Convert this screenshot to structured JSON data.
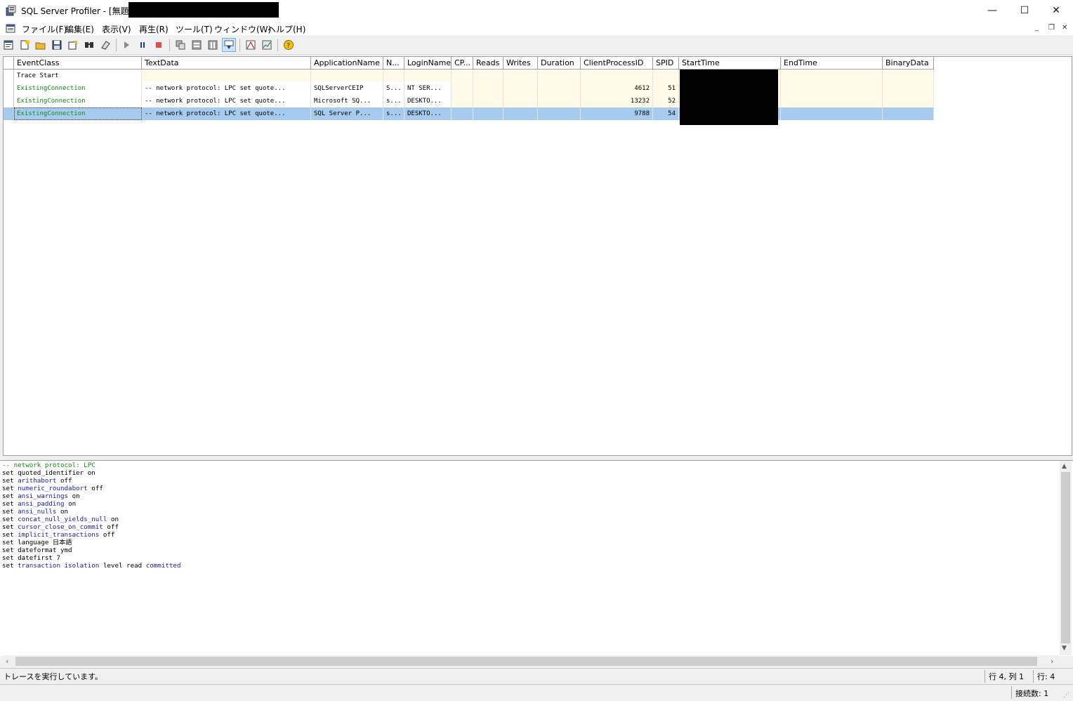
{
  "window": {
    "title": "SQL Server Profiler - [無題 - 2",
    "controls": {
      "minimize": "—",
      "maximize": "☐",
      "close": "✕"
    }
  },
  "menu": {
    "items": [
      "ファイル(F)",
      "編集(E)",
      "表示(V)",
      "再生(R)",
      "ツール(T)",
      "ウィンドウ(W)",
      "ヘルプ(H)"
    ],
    "mdi_controls": {
      "minimize": "_",
      "restore": "❐",
      "close": "✕"
    }
  },
  "toolbar": {
    "buttons": [
      "properties-icon",
      "new-trace-icon",
      "open-icon",
      "save-icon",
      "template-icon",
      "find-icon",
      "clear-icon",
      "play-icon",
      "pause-icon",
      "stop-icon",
      "group-icon",
      "filter-icon",
      "columns-icon",
      "autoscroll-icon",
      "perfmon-icon",
      "chart-icon",
      "help-icon"
    ]
  },
  "grid": {
    "columns": [
      "EventClass",
      "TextData",
      "ApplicationName",
      "N...",
      "LoginName",
      "CP...",
      "Reads",
      "Writes",
      "Duration",
      "ClientProcessID",
      "SPID",
      "StartTime",
      "EndTime",
      "BinaryData"
    ],
    "rows": [
      {
        "EventClass": "Trace Start",
        "TextData": "",
        "ApplicationName": "",
        "NTUserName": "",
        "LoginName": "",
        "CPU": "",
        "Reads": "",
        "Writes": "",
        "Duration": "",
        "ClientProcessID": "",
        "SPID": "",
        "StartTime": "",
        "EndTime": "",
        "BinaryData": ""
      },
      {
        "EventClass": "ExistingConnection",
        "TextData": "-- network protocol: LPC  set quote...",
        "ApplicationName": "SQLServerCEIP",
        "NTUserName": "S...",
        "LoginName": "NT SER...",
        "CPU": "",
        "Reads": "",
        "Writes": "",
        "Duration": "",
        "ClientProcessID": "4612",
        "SPID": "51",
        "StartTime": "",
        "EndTime": "",
        "BinaryData": ""
      },
      {
        "EventClass": "ExistingConnection",
        "TextData": "-- network protocol: LPC  set quote...",
        "ApplicationName": "Microsoft SQ...",
        "NTUserName": "s...",
        "LoginName": "DESKTO...",
        "CPU": "",
        "Reads": "",
        "Writes": "",
        "Duration": "",
        "ClientProcessID": "13232",
        "SPID": "52",
        "StartTime": "",
        "EndTime": "",
        "BinaryData": ""
      },
      {
        "EventClass": "ExistingConnection",
        "TextData": "-- network protocol: LPC  set quote...",
        "ApplicationName": "SQL Server P...",
        "NTUserName": "s...",
        "LoginName": "DESKTO...",
        "CPU": "",
        "Reads": "",
        "Writes": "",
        "Duration": "",
        "ClientProcessID": "9788",
        "SPID": "54",
        "StartTime": "",
        "EndTime": "",
        "BinaryData": ""
      }
    ],
    "selected_row": 3
  },
  "detail": {
    "lines": [
      {
        "parts": [
          {
            "t": "-- network protocol: LPC",
            "c": "cm"
          }
        ]
      },
      {
        "parts": [
          {
            "t": "set quoted_identifier on",
            "c": ""
          }
        ]
      },
      {
        "parts": [
          {
            "t": "set ",
            "c": ""
          },
          {
            "t": "arithabort",
            "c": "kw"
          },
          {
            "t": " off",
            "c": ""
          }
        ]
      },
      {
        "parts": [
          {
            "t": "set ",
            "c": ""
          },
          {
            "t": "numeric_roundabort",
            "c": "kw"
          },
          {
            "t": " off",
            "c": ""
          }
        ]
      },
      {
        "parts": [
          {
            "t": "set ",
            "c": ""
          },
          {
            "t": "ansi_warnings",
            "c": "kw"
          },
          {
            "t": " on",
            "c": ""
          }
        ]
      },
      {
        "parts": [
          {
            "t": "set ",
            "c": ""
          },
          {
            "t": "ansi_padding",
            "c": "kw"
          },
          {
            "t": " on",
            "c": ""
          }
        ]
      },
      {
        "parts": [
          {
            "t": "set ",
            "c": ""
          },
          {
            "t": "ansi_nulls",
            "c": "kw"
          },
          {
            "t": " on",
            "c": ""
          }
        ]
      },
      {
        "parts": [
          {
            "t": "set ",
            "c": ""
          },
          {
            "t": "concat_null_yields_null",
            "c": "kw"
          },
          {
            "t": " on",
            "c": ""
          }
        ]
      },
      {
        "parts": [
          {
            "t": "set ",
            "c": ""
          },
          {
            "t": "cursor_close_on_commit",
            "c": "kw"
          },
          {
            "t": " off",
            "c": ""
          }
        ]
      },
      {
        "parts": [
          {
            "t": "set ",
            "c": ""
          },
          {
            "t": "implicit_transactions",
            "c": "kw"
          },
          {
            "t": " off",
            "c": ""
          }
        ]
      },
      {
        "parts": [
          {
            "t": "set language 日本語",
            "c": ""
          }
        ]
      },
      {
        "parts": [
          {
            "t": "set dateformat ymd",
            "c": ""
          }
        ]
      },
      {
        "parts": [
          {
            "t": "set datefirst 7",
            "c": ""
          }
        ]
      },
      {
        "parts": [
          {
            "t": "set ",
            "c": ""
          },
          {
            "t": "transaction isolation",
            "c": "kw"
          },
          {
            "t": " level read ",
            "c": ""
          },
          {
            "t": "committed",
            "c": "kw"
          }
        ]
      }
    ]
  },
  "status": {
    "message": "トレースを実行しています。",
    "position": "行 4, 列 1",
    "rows": "行: 4",
    "connections": "接続数: 1"
  },
  "colors": {
    "selected_row": "#a6cbef",
    "row_tint": "#fffbe8",
    "event_text": "#148c14",
    "keyword": "#1c1cb4"
  }
}
